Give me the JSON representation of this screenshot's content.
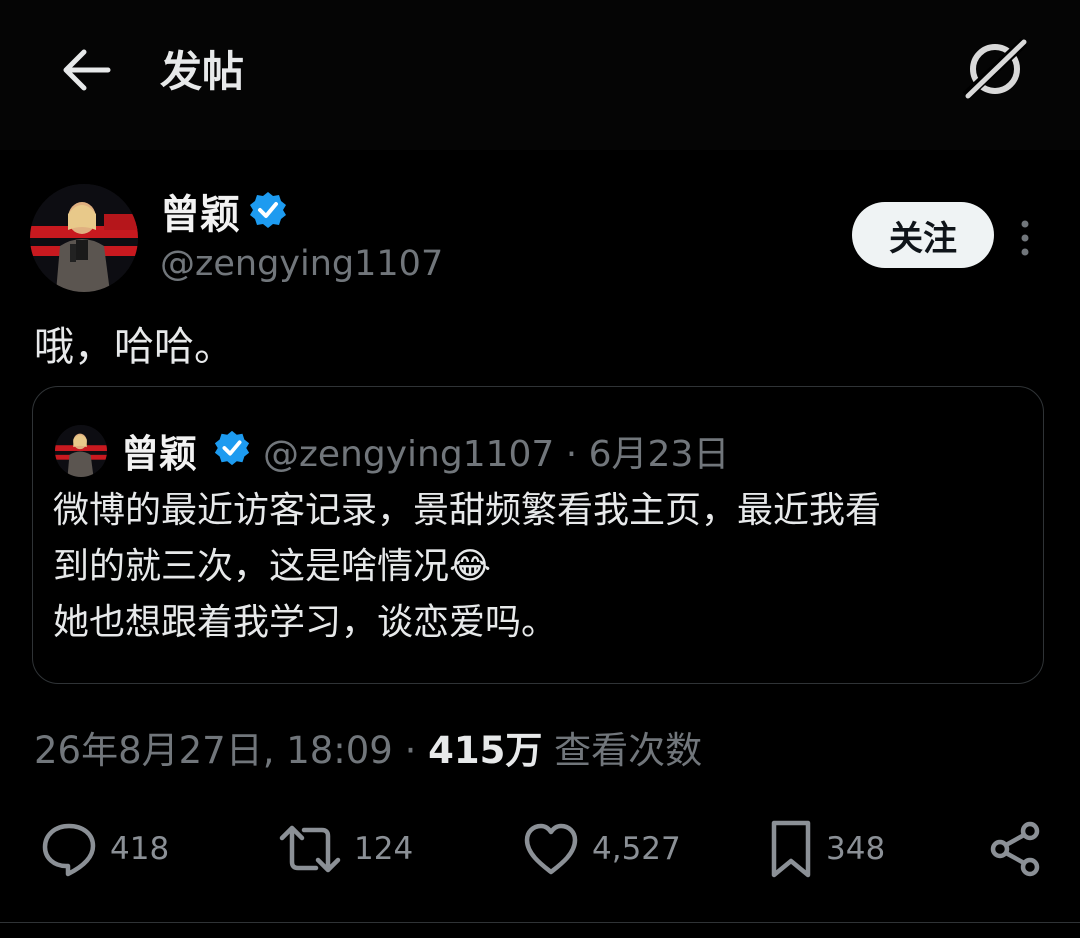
{
  "header": {
    "title": "发帖",
    "back_icon": "arrow-left-icon",
    "grok_icon": "grok-icon"
  },
  "post": {
    "author_name": "曾颖",
    "author_handle": "@zengying1107",
    "follow_label": "关注",
    "text": "哦，哈哈。",
    "timestamp": "26年8月27日, 18:09",
    "separator": "·",
    "views_count": "415万",
    "views_label": "查看次数"
  },
  "quote": {
    "author_name": "曾颖",
    "author_handle": "@zengying1107",
    "date": "· 6月23日",
    "lines": [
      "微博的最近访客记录，景甜频繁看我主页，最近我看",
      "到的就三次，这是啥情况😂",
      "她也想跟着我学习，谈恋爱吗。"
    ]
  },
  "actions": {
    "replies": "418",
    "reposts": "124",
    "likes": "4,527",
    "bookmarks": "348"
  },
  "colors": {
    "background": "#000000",
    "text": "#e7e9ea",
    "muted": "#71767b",
    "verified": "#1d9bf0",
    "border": "#2f3336"
  }
}
